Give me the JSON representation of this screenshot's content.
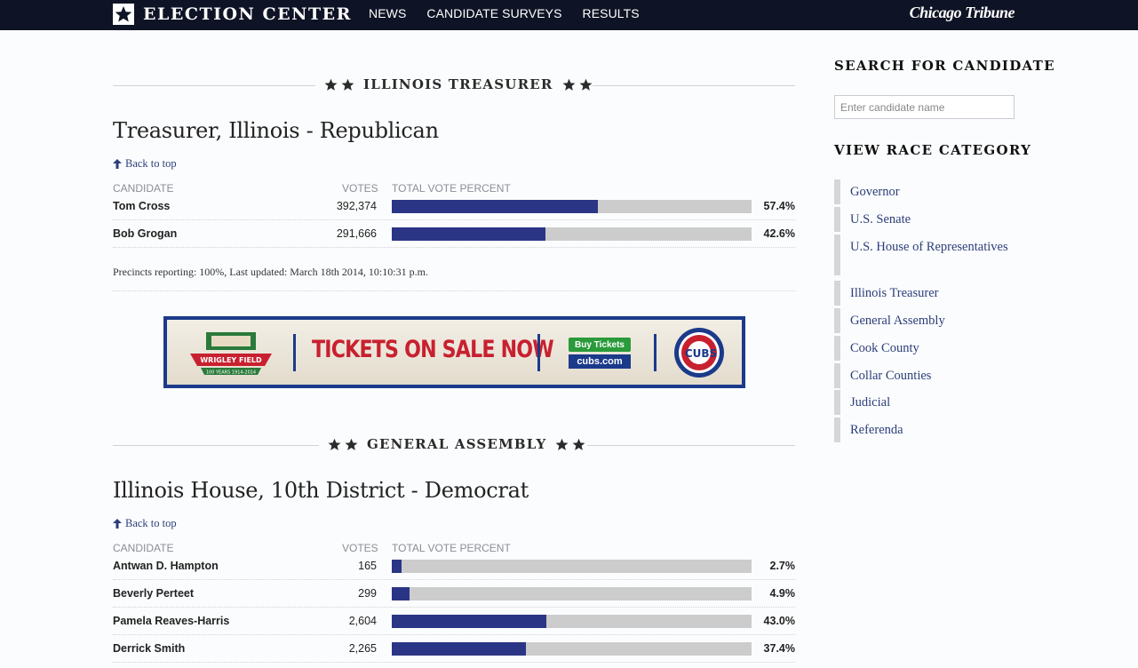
{
  "header": {
    "brand": "ELECTION CENTER",
    "nav": [
      "NEWS",
      "CANDIDATE SURVEYS",
      "RESULTS"
    ],
    "tribune": "Chicago Tribune"
  },
  "sections": [
    {
      "heading": "ILLINOIS TREASURER",
      "race_title": "Treasurer, Illinois - Republican",
      "back_to_top": "Back to top",
      "columns": [
        "CANDIDATE",
        "VOTES",
        "TOTAL VOTE PERCENT"
      ],
      "rows": [
        {
          "name": "Tom Cross",
          "votes": "392,374",
          "pct": "57.4%",
          "share": 57.4
        },
        {
          "name": "Bob Grogan",
          "votes": "291,666",
          "pct": "42.6%",
          "share": 42.6
        }
      ],
      "precincts": "Precincts reporting: 100%, Last updated: March 18th 2014, 10:10:31 p.m."
    },
    {
      "heading": "GENERAL ASSEMBLY",
      "race_title": "Illinois House, 10th District - Democrat",
      "back_to_top": "Back to top",
      "columns": [
        "CANDIDATE",
        "VOTES",
        "TOTAL VOTE PERCENT"
      ],
      "rows": [
        {
          "name": "Antwan D. Hampton",
          "votes": "165",
          "pct": "2.7%",
          "share": 2.7
        },
        {
          "name": "Beverly Perteet",
          "votes": "299",
          "pct": "4.9%",
          "share": 4.9
        },
        {
          "name": "Pamela Reaves-Harris",
          "votes": "2,604",
          "pct": "43.0%",
          "share": 43.0
        },
        {
          "name": "Derrick Smith",
          "votes": "2,265",
          "pct": "37.4%",
          "share": 37.4
        }
      ]
    }
  ],
  "ad": {
    "logo_text": "WRIGLEY FIELD",
    "logo_years": "100 YEARS 1914-2014",
    "headline": "TICKETS ON SALE NOW",
    "buy": "Buy Tickets",
    "site": "cubs.com",
    "cubs": "CUBS"
  },
  "sidebar": {
    "search_title": "SEARCH FOR CANDIDATE",
    "search_placeholder": "Enter candidate name",
    "category_title": "VIEW RACE CATEGORY",
    "categories": [
      "Governor",
      "U.S. Senate",
      "U.S. House of Representatives",
      "Illinois Treasurer",
      "General Assembly",
      "Cook County",
      "Collar Counties",
      "Judicial",
      "Referenda"
    ]
  },
  "colors": {
    "topbar": "#0e1325",
    "bar_fill": "#2b3585",
    "bar_track": "#cccccc",
    "link": "#2c3e7a",
    "ad_red": "#c8202f"
  }
}
